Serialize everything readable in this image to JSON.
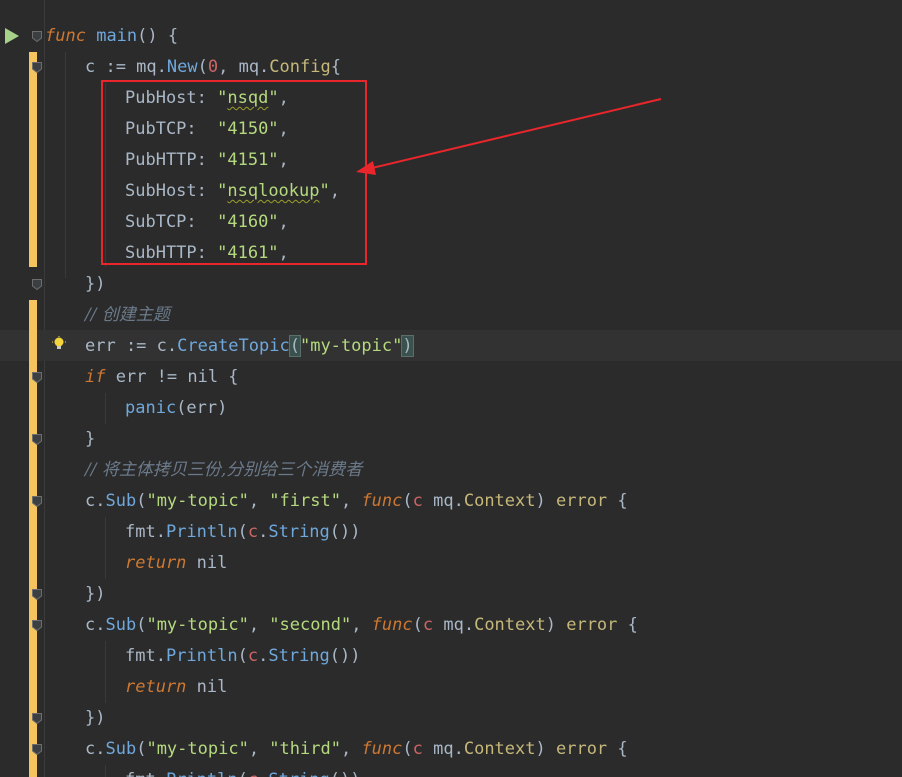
{
  "editor": {
    "lines": [
      [
        [
          "kw",
          "func"
        ],
        [
          "plain",
          " "
        ],
        [
          "fn",
          "main"
        ],
        [
          "plain",
          "() {"
        ]
      ],
      [
        [
          "plain",
          "c := mq."
        ],
        [
          "fn",
          "New"
        ],
        [
          "plain",
          "("
        ],
        [
          "num",
          "0"
        ],
        [
          "plain",
          ", mq."
        ],
        [
          "typ",
          "Config"
        ],
        [
          "plain",
          "{"
        ]
      ],
      [
        [
          "plain",
          "PubHost: "
        ],
        [
          "str",
          "\""
        ],
        [
          "str_typo",
          "nsqd"
        ],
        [
          "str",
          "\""
        ],
        [
          "plain",
          ","
        ]
      ],
      [
        [
          "plain",
          "PubTCP:  "
        ],
        [
          "str",
          "\"4150\""
        ],
        [
          "plain",
          ","
        ]
      ],
      [
        [
          "plain",
          "PubHTTP: "
        ],
        [
          "str",
          "\"4151\""
        ],
        [
          "plain",
          ","
        ]
      ],
      [
        [
          "plain",
          "SubHost: "
        ],
        [
          "str",
          "\""
        ],
        [
          "str_typo",
          "nsqlookup"
        ],
        [
          "str",
          "\""
        ],
        [
          "plain",
          ","
        ]
      ],
      [
        [
          "plain",
          "SubTCP:  "
        ],
        [
          "str",
          "\"4160\""
        ],
        [
          "plain",
          ","
        ]
      ],
      [
        [
          "plain",
          "SubHTTP: "
        ],
        [
          "str",
          "\"4161\""
        ],
        [
          "plain",
          ","
        ]
      ],
      [
        [
          "plain",
          "})"
        ]
      ],
      [
        [
          "cm",
          "// 创建主题"
        ]
      ],
      [
        [
          "plain",
          "err := c."
        ],
        [
          "fn",
          "CreateTopic"
        ],
        [
          "bracket",
          "("
        ],
        [
          "str",
          "\"my-topic\""
        ],
        [
          "bracket",
          ")"
        ]
      ],
      [
        [
          "kw",
          "if"
        ],
        [
          "plain",
          " err != nil {"
        ]
      ],
      [
        [
          "fn",
          "panic"
        ],
        [
          "plain",
          "(err)"
        ]
      ],
      [
        [
          "plain",
          "}"
        ]
      ],
      [
        [
          "cm",
          "// 将主体拷贝三份,分别给三个消费者"
        ]
      ],
      [
        [
          "plain",
          "c."
        ],
        [
          "fn",
          "Sub"
        ],
        [
          "plain",
          "("
        ],
        [
          "str",
          "\"my-topic\""
        ],
        [
          "plain",
          ", "
        ],
        [
          "str",
          "\"first\""
        ],
        [
          "plain",
          ", "
        ],
        [
          "kw",
          "func"
        ],
        [
          "plain",
          "("
        ],
        [
          "param",
          "c"
        ],
        [
          "plain",
          " mq."
        ],
        [
          "typ",
          "Context"
        ],
        [
          "plain",
          ") "
        ],
        [
          "typ",
          "error"
        ],
        [
          "plain",
          " {"
        ]
      ],
      [
        [
          "plain",
          "fmt."
        ],
        [
          "fn",
          "Println"
        ],
        [
          "plain",
          "("
        ],
        [
          "param",
          "c"
        ],
        [
          "plain",
          "."
        ],
        [
          "fn",
          "String"
        ],
        [
          "plain",
          "())"
        ]
      ],
      [
        [
          "kw",
          "return"
        ],
        [
          "plain",
          " nil"
        ]
      ],
      [
        [
          "plain",
          "})"
        ]
      ],
      [
        [
          "plain",
          "c."
        ],
        [
          "fn",
          "Sub"
        ],
        [
          "plain",
          "("
        ],
        [
          "str",
          "\"my-topic\""
        ],
        [
          "plain",
          ", "
        ],
        [
          "str",
          "\"second\""
        ],
        [
          "plain",
          ", "
        ],
        [
          "kw",
          "func"
        ],
        [
          "plain",
          "("
        ],
        [
          "param",
          "c"
        ],
        [
          "plain",
          " mq."
        ],
        [
          "typ",
          "Context"
        ],
        [
          "plain",
          ") "
        ],
        [
          "typ",
          "error"
        ],
        [
          "plain",
          " {"
        ]
      ],
      [
        [
          "plain",
          "fmt."
        ],
        [
          "fn",
          "Println"
        ],
        [
          "plain",
          "("
        ],
        [
          "param",
          "c"
        ],
        [
          "plain",
          "."
        ],
        [
          "fn",
          "String"
        ],
        [
          "plain",
          "())"
        ]
      ],
      [
        [
          "kw",
          "return"
        ],
        [
          "plain",
          " nil"
        ]
      ],
      [
        [
          "plain",
          "})"
        ]
      ],
      [
        [
          "plain",
          "c."
        ],
        [
          "fn",
          "Sub"
        ],
        [
          "plain",
          "("
        ],
        [
          "str",
          "\"my-topic\""
        ],
        [
          "plain",
          ", "
        ],
        [
          "str",
          "\"third\""
        ],
        [
          "plain",
          ", "
        ],
        [
          "kw",
          "func"
        ],
        [
          "plain",
          "("
        ],
        [
          "param",
          "c"
        ],
        [
          "plain",
          " mq."
        ],
        [
          "typ",
          "Context"
        ],
        [
          "plain",
          ") "
        ],
        [
          "typ",
          "error"
        ],
        [
          "plain",
          " {"
        ]
      ],
      [
        [
          "plain",
          "fmt."
        ],
        [
          "fn",
          "Println"
        ],
        [
          "plain",
          "("
        ],
        [
          "param",
          "c"
        ],
        [
          "plain",
          "."
        ],
        [
          "fn",
          "String"
        ],
        [
          "plain",
          "())"
        ]
      ]
    ]
  },
  "icons": {
    "run": "run-icon",
    "bulb": "lightbulb-icon",
    "fold": "fold-marker-icon"
  },
  "colors": {
    "background": "#2b2b2b",
    "highlight_box": "#e8262b",
    "vcs_modified": "#f5c45f"
  }
}
